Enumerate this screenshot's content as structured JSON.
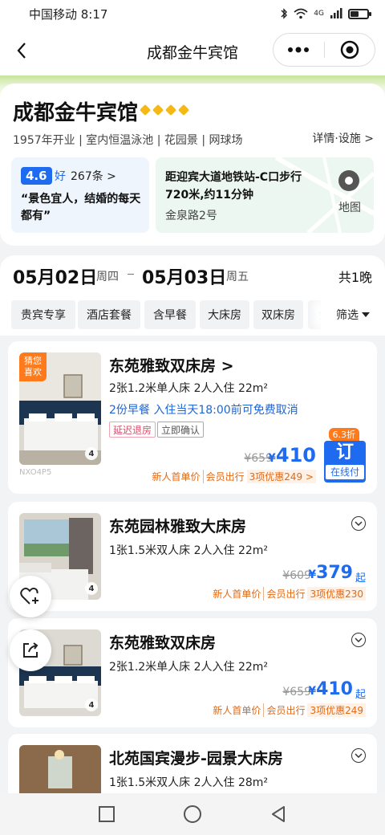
{
  "status_bar": {
    "carrier_time": "中国移动 8:17",
    "network": "4G"
  },
  "nav": {
    "title": "成都金牛宾馆"
  },
  "hotel": {
    "name": "成都金牛宾馆",
    "tags": "1957年开业 | 室内恒温泳池 | 花园景 | 网球场",
    "detail_link": "详情·设施 >",
    "rating": {
      "score": "4.6",
      "word": "好",
      "count": "267条 >",
      "quote": "“景色宜人，结婚的每天都有”"
    },
    "location": {
      "text": "距迎宾大道地铁站-C口步行720米,约11分钟",
      "address": "金泉路2号",
      "map_label": "地图"
    }
  },
  "dates": {
    "checkin": "05月02日",
    "checkin_weekday": "周四",
    "checkout": "05月03日",
    "checkout_weekday": "周五",
    "nights": "共1晚"
  },
  "filters": {
    "chips": [
      "贵宾专享",
      "酒店套餐",
      "含早餐",
      "大床房",
      "双床房",
      "免"
    ],
    "filter_label": "筛选"
  },
  "rooms": [
    {
      "name": "东苑雅致双床房 >",
      "spec": "2张1.2米单人床  2人入住  22m²",
      "perk": "2份早餐  入住当天18:00前可免费取消",
      "tags": [
        "延迟退房",
        "立即确认"
      ],
      "badge": "猜您\n喜欢",
      "img_count": "4",
      "img_watermark": "NXO4P5",
      "old_price": "¥659",
      "yen": "¥",
      "price": "410",
      "promos": [
        "新人首单价",
        "会员出行",
        "3项优惠249 >"
      ],
      "discount": "6.3折",
      "book_big": "订",
      "book_small": "在线付"
    },
    {
      "name": "东苑园林雅致大床房",
      "spec": "1张1.5米双人床  2人入住  22m²",
      "img_count": "4",
      "old_price": "¥609",
      "yen": "¥",
      "price": "379",
      "qi": "起",
      "promos": [
        "新人首单价",
        "会员出行",
        "3项优惠230"
      ]
    },
    {
      "name": "东苑雅致双床房",
      "spec": "2张1.2米单人床  2人入住  22m²",
      "img_count": "4",
      "old_price": "¥659",
      "yen": "¥",
      "price": "410",
      "qi": "起",
      "promos": [
        "新人首单价",
        "会员出行",
        "3项优惠249"
      ]
    },
    {
      "name": "北苑国宾漫步-园景大床房",
      "spec": "1张1.5米双人床  2人入住  28m²"
    }
  ],
  "colors": {
    "accent_blue": "#1f6bf0",
    "promo_orange": "#e06a17",
    "badge_orange": "#ff7a1a",
    "star_gold": "#f5b915"
  },
  "icons": [
    "back-icon",
    "more-icon",
    "target-icon",
    "chevron-right-icon",
    "map-pin-icon",
    "chevron-down-icon",
    "heart-plus-icon",
    "share-icon",
    "square-icon",
    "circle-icon",
    "triangle-back-icon"
  ]
}
